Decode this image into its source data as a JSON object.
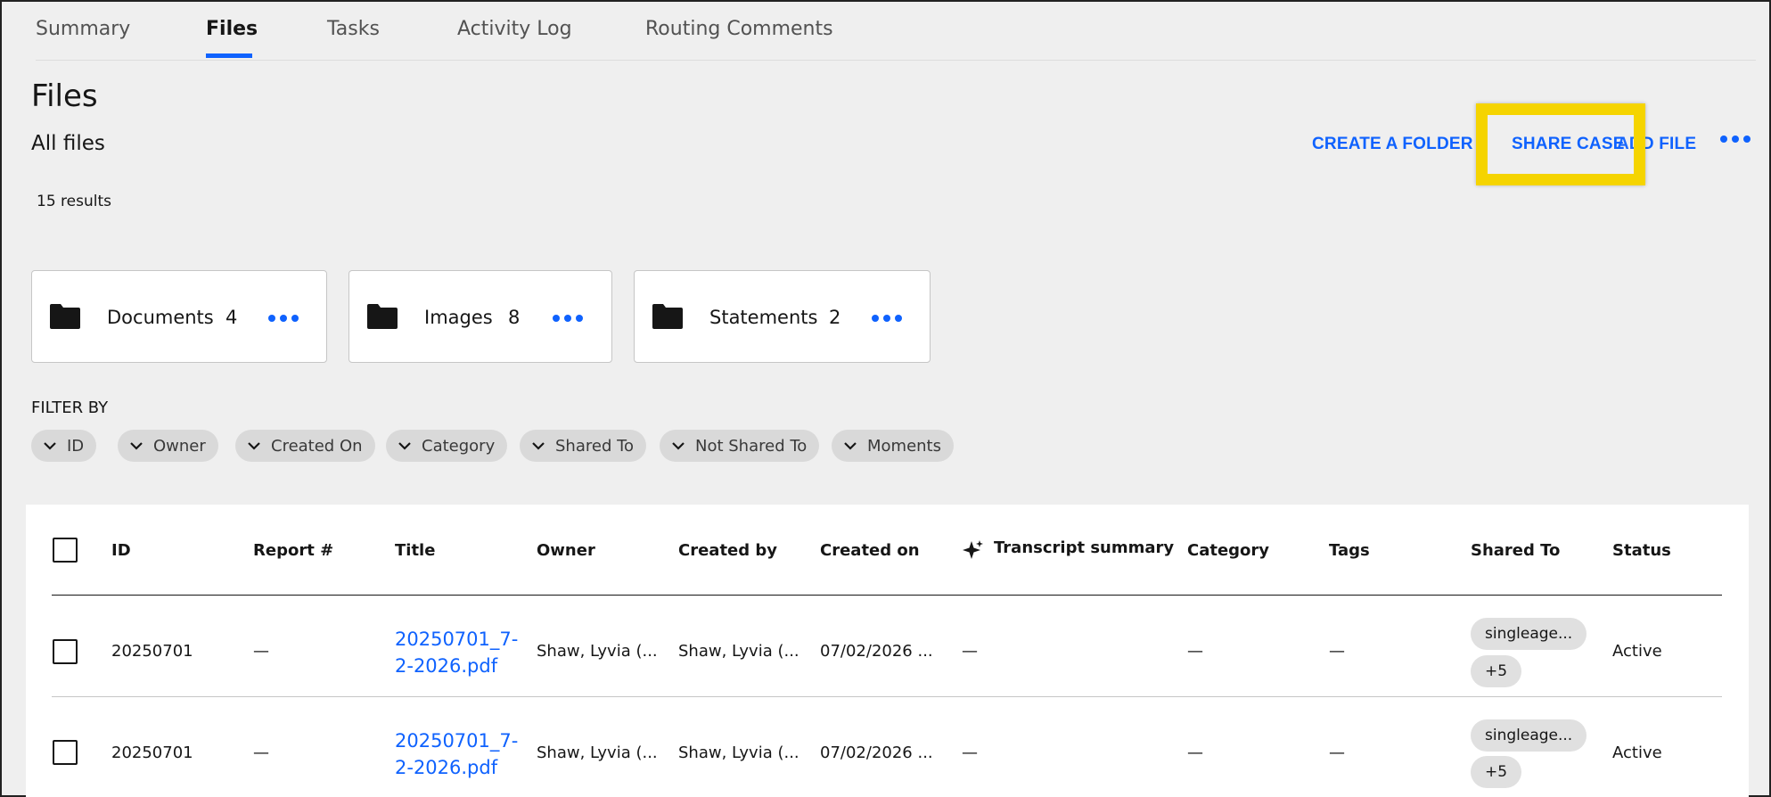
{
  "tabs": [
    {
      "label": "Summary",
      "active": false
    },
    {
      "label": "Files",
      "active": true
    },
    {
      "label": "Tasks",
      "active": false
    },
    {
      "label": "Activity Log",
      "active": false
    },
    {
      "label": "Routing Comments",
      "active": false
    }
  ],
  "page": {
    "title": "Files",
    "section_title": "All files",
    "results": "15 results"
  },
  "actions": {
    "create_folder": "CREATE A FOLDER",
    "share_case": "SHARE CASE",
    "add_file": "ADD FILE"
  },
  "folders": [
    {
      "name": "Documents",
      "count": "4"
    },
    {
      "name": "Images",
      "count": "8"
    },
    {
      "name": "Statements",
      "count": "2"
    }
  ],
  "filter": {
    "label": "FILTER BY",
    "chips": [
      "ID",
      "Owner",
      "Created On",
      "Category",
      "Shared To",
      "Not Shared To",
      "Moments"
    ]
  },
  "table": {
    "columns": [
      "ID",
      "Report #",
      "Title",
      "Owner",
      "Created by",
      "Created on",
      "Transcript summary",
      "Category",
      "Tags",
      "Shared To",
      "Status"
    ],
    "rows": [
      {
        "id": "20250701",
        "report": "—",
        "title": "20250701_7-2-2026.pdf",
        "owner": "Shaw, Lyvia (...",
        "created_by": "Shaw, Lyvia (...",
        "created_on": "07/02/2026 ...",
        "transcript": "—",
        "category": "—",
        "tags": "—",
        "shared_to": "singleage...",
        "shared_more": "+5",
        "status": "Active"
      },
      {
        "id": "20250701",
        "report": "—",
        "title": "20250701_7-2-2026.pdf",
        "owner": "Shaw, Lyvia (...",
        "created_by": "Shaw, Lyvia (...",
        "created_on": "07/02/2026 ...",
        "transcript": "—",
        "category": "—",
        "tags": "—",
        "shared_to": "singleage...",
        "shared_more": "+5",
        "status": "Active"
      }
    ]
  },
  "icons": {
    "folder": "folder-icon",
    "overflow": "overflow-menu-icon",
    "chevron": "chevron-down-icon",
    "sparkle": "sparkle-icon"
  },
  "colors": {
    "accent": "#0f62fe",
    "highlight": "#f5d400",
    "background": "#efefef"
  }
}
